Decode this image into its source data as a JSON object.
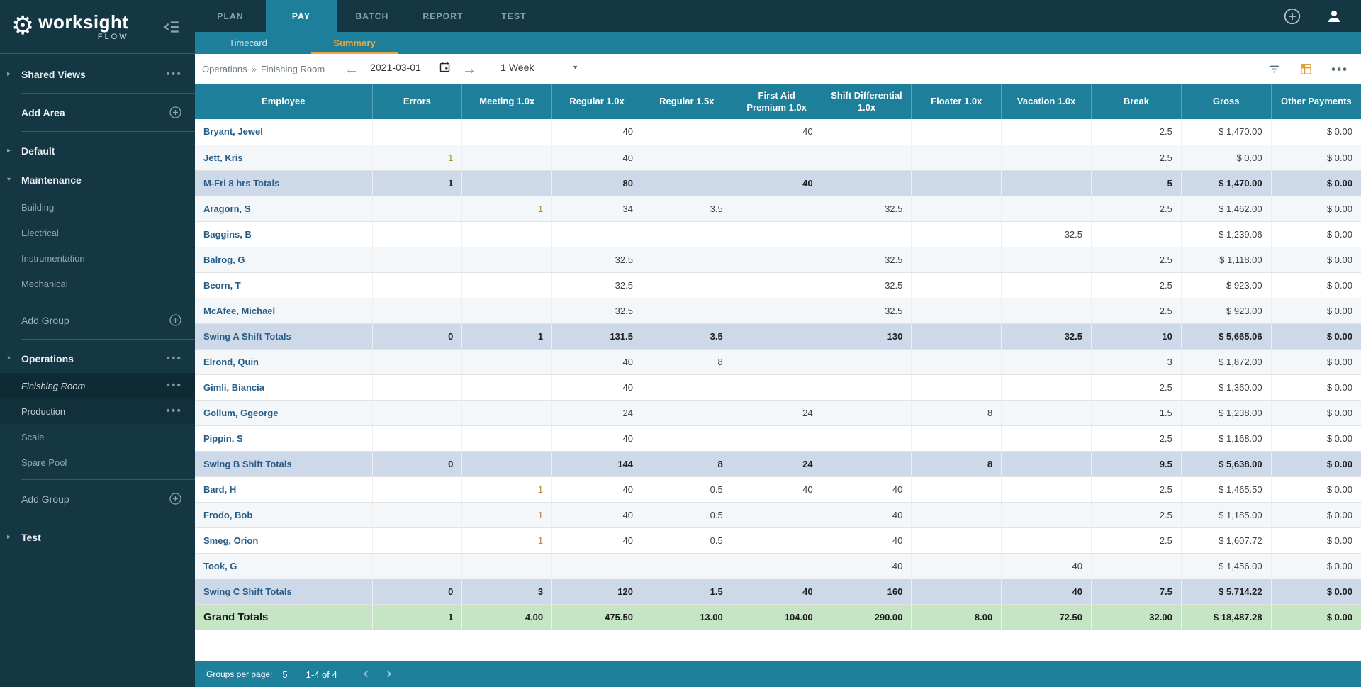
{
  "brand": {
    "name": "worksight",
    "sub": "FLOW"
  },
  "topnav": {
    "tabs": [
      {
        "label": "PLAN",
        "active": false
      },
      {
        "label": "PAY",
        "active": true
      },
      {
        "label": "BATCH",
        "active": false
      },
      {
        "label": "REPORT",
        "active": false
      },
      {
        "label": "TEST",
        "active": false
      }
    ]
  },
  "subnav": {
    "tabs": [
      {
        "label": "Timecard",
        "active": false
      },
      {
        "label": "Summary",
        "active": true
      }
    ]
  },
  "toolbar": {
    "breadcrumb": {
      "parent": "Operations",
      "separator": "»",
      "current": "Finishing Room"
    },
    "date_value": "2021-03-01",
    "range_value": "1 Week"
  },
  "sidebar": {
    "items": [
      {
        "kind": "section",
        "label": "Shared Views",
        "arrow": "right",
        "more": true
      },
      {
        "kind": "divider"
      },
      {
        "kind": "action",
        "label": "Add Area",
        "muted": false
      },
      {
        "kind": "divider"
      },
      {
        "kind": "section",
        "label": "Default",
        "arrow": "right"
      },
      {
        "kind": "section",
        "label": "Maintenance",
        "arrow": "down"
      },
      {
        "kind": "child",
        "label": "Building"
      },
      {
        "kind": "child",
        "label": "Electrical"
      },
      {
        "kind": "child",
        "label": "Instrumentation"
      },
      {
        "kind": "child",
        "label": "Mechanical"
      },
      {
        "kind": "divider"
      },
      {
        "kind": "action",
        "label": "Add Group",
        "muted": true
      },
      {
        "kind": "divider"
      },
      {
        "kind": "section",
        "label": "Operations",
        "arrow": "down",
        "more": true
      },
      {
        "kind": "child",
        "label": "Finishing Room",
        "selected": true,
        "more": true
      },
      {
        "kind": "child",
        "label": "Production",
        "highlight": true,
        "more": true
      },
      {
        "kind": "child",
        "label": "Scale"
      },
      {
        "kind": "child",
        "label": "Spare Pool"
      },
      {
        "kind": "divider"
      },
      {
        "kind": "action",
        "label": "Add Group",
        "muted": true
      },
      {
        "kind": "divider"
      },
      {
        "kind": "section",
        "label": "Test",
        "arrow": "right"
      }
    ]
  },
  "table": {
    "columns": [
      "Employee",
      "Errors",
      "Meeting 1.0x",
      "Regular 1.0x",
      "Regular 1.5x",
      "First Aid Premium 1.0x",
      "Shift Differential 1.0x",
      "Floater 1.0x",
      "Vacation 1.0x",
      "Break",
      "Gross",
      "Other Payments"
    ],
    "rows": [
      {
        "type": "employee",
        "name": "Bryant, Jewel",
        "values": [
          "",
          "",
          "40",
          "",
          "40",
          "",
          "",
          "",
          "2.5",
          "$ 1,470.00",
          "$ 0.00"
        ]
      },
      {
        "type": "employee",
        "name": "Jett, Kris",
        "values": [
          "1",
          "",
          "40",
          "",
          "",
          "",
          "",
          "",
          "2.5",
          "$ 0.00",
          "$ 0.00"
        ]
      },
      {
        "type": "subtotal",
        "name": "M-Fri 8 hrs Totals",
        "values": [
          "1",
          "",
          "80",
          "",
          "40",
          "",
          "",
          "",
          "5",
          "$ 1,470.00",
          "$ 0.00"
        ]
      },
      {
        "type": "employee",
        "name": "Aragorn, S",
        "values": [
          "",
          "1",
          "34",
          "3.5",
          "",
          "32.5",
          "",
          "",
          "2.5",
          "$ 1,462.00",
          "$ 0.00"
        ]
      },
      {
        "type": "employee",
        "name": "Baggins, B",
        "values": [
          "",
          "",
          "",
          "",
          "",
          "",
          "",
          "32.5",
          "",
          "$ 1,239.06",
          "$ 0.00"
        ]
      },
      {
        "type": "employee",
        "name": "Balrog, G",
        "values": [
          "",
          "",
          "32.5",
          "",
          "",
          "32.5",
          "",
          "",
          "2.5",
          "$ 1,118.00",
          "$ 0.00"
        ]
      },
      {
        "type": "employee",
        "name": "Beorn, T",
        "values": [
          "",
          "",
          "32.5",
          "",
          "",
          "32.5",
          "",
          "",
          "2.5",
          "$ 923.00",
          "$ 0.00"
        ]
      },
      {
        "type": "employee",
        "name": "McAfee, Michael",
        "values": [
          "",
          "",
          "32.5",
          "",
          "",
          "32.5",
          "",
          "",
          "2.5",
          "$ 923.00",
          "$ 0.00"
        ]
      },
      {
        "type": "subtotal",
        "name": "Swing A Shift Totals",
        "values": [
          "0",
          "1",
          "131.5",
          "3.5",
          "",
          "130",
          "",
          "32.5",
          "10",
          "$ 5,665.06",
          "$ 0.00"
        ]
      },
      {
        "type": "employee",
        "name": "Elrond, Quin",
        "values": [
          "",
          "",
          "40",
          "8",
          "",
          "",
          "",
          "",
          "3",
          "$ 1,872.00",
          "$ 0.00"
        ]
      },
      {
        "type": "employee",
        "name": "Gimli, Biancia",
        "values": [
          "",
          "",
          "40",
          "",
          "",
          "",
          "",
          "",
          "2.5",
          "$ 1,360.00",
          "$ 0.00"
        ]
      },
      {
        "type": "employee",
        "name": "Gollum, Ggeorge",
        "values": [
          "",
          "",
          "24",
          "",
          "24",
          "",
          "8",
          "",
          "1.5",
          "$ 1,238.00",
          "$ 0.00"
        ]
      },
      {
        "type": "employee",
        "name": "Pippin, S",
        "values": [
          "",
          "",
          "40",
          "",
          "",
          "",
          "",
          "",
          "2.5",
          "$ 1,168.00",
          "$ 0.00"
        ]
      },
      {
        "type": "subtotal",
        "name": "Swing B Shift Totals",
        "values": [
          "0",
          "",
          "144",
          "8",
          "24",
          "",
          "8",
          "",
          "9.5",
          "$ 5,638.00",
          "$ 0.00"
        ]
      },
      {
        "type": "employee",
        "name": "Bard, H",
        "values": [
          "",
          "1",
          "40",
          "0.5",
          "40",
          "40",
          "",
          "",
          "2.5",
          "$ 1,465.50",
          "$ 0.00"
        ]
      },
      {
        "type": "employee",
        "name": "Frodo, Bob",
        "values": [
          "",
          "1",
          "40",
          "0.5",
          "",
          "40",
          "",
          "",
          "2.5",
          "$ 1,185.00",
          "$ 0.00"
        ]
      },
      {
        "type": "employee",
        "name": "Smeg, Orion",
        "values": [
          "",
          "1",
          "40",
          "0.5",
          "",
          "40",
          "",
          "",
          "2.5",
          "$ 1,607.72",
          "$ 0.00"
        ]
      },
      {
        "type": "employee",
        "name": "Took, G",
        "values": [
          "",
          "",
          "",
          "",
          "",
          "40",
          "",
          "40",
          "",
          "$ 1,456.00",
          "$ 0.00"
        ]
      },
      {
        "type": "subtotal",
        "name": "Swing C Shift Totals",
        "values": [
          "0",
          "3",
          "120",
          "1.5",
          "40",
          "160",
          "",
          "40",
          "7.5",
          "$ 5,714.22",
          "$ 0.00"
        ]
      },
      {
        "type": "grand",
        "name": "Grand Totals",
        "values": [
          "1",
          "4.00",
          "475.50",
          "13.00",
          "104.00",
          "290.00",
          "8.00",
          "72.50",
          "32.00",
          "$ 18,487.28",
          "$ 0.00"
        ]
      }
    ]
  },
  "footer": {
    "groups_per_page_label": "Groups per page:",
    "page_size": "5",
    "range": "1-4 of 4"
  },
  "colors": {
    "dark_teal": "#153744",
    "teal": "#1d7f9a",
    "amber_accent": "#eaa83e",
    "subtotal_bg": "#cdd9e9",
    "grand_bg": "#c5e5c5",
    "employee_name": "#275d87",
    "amber_value": "#ad8a2e",
    "green_arrow": "#7cb342"
  }
}
